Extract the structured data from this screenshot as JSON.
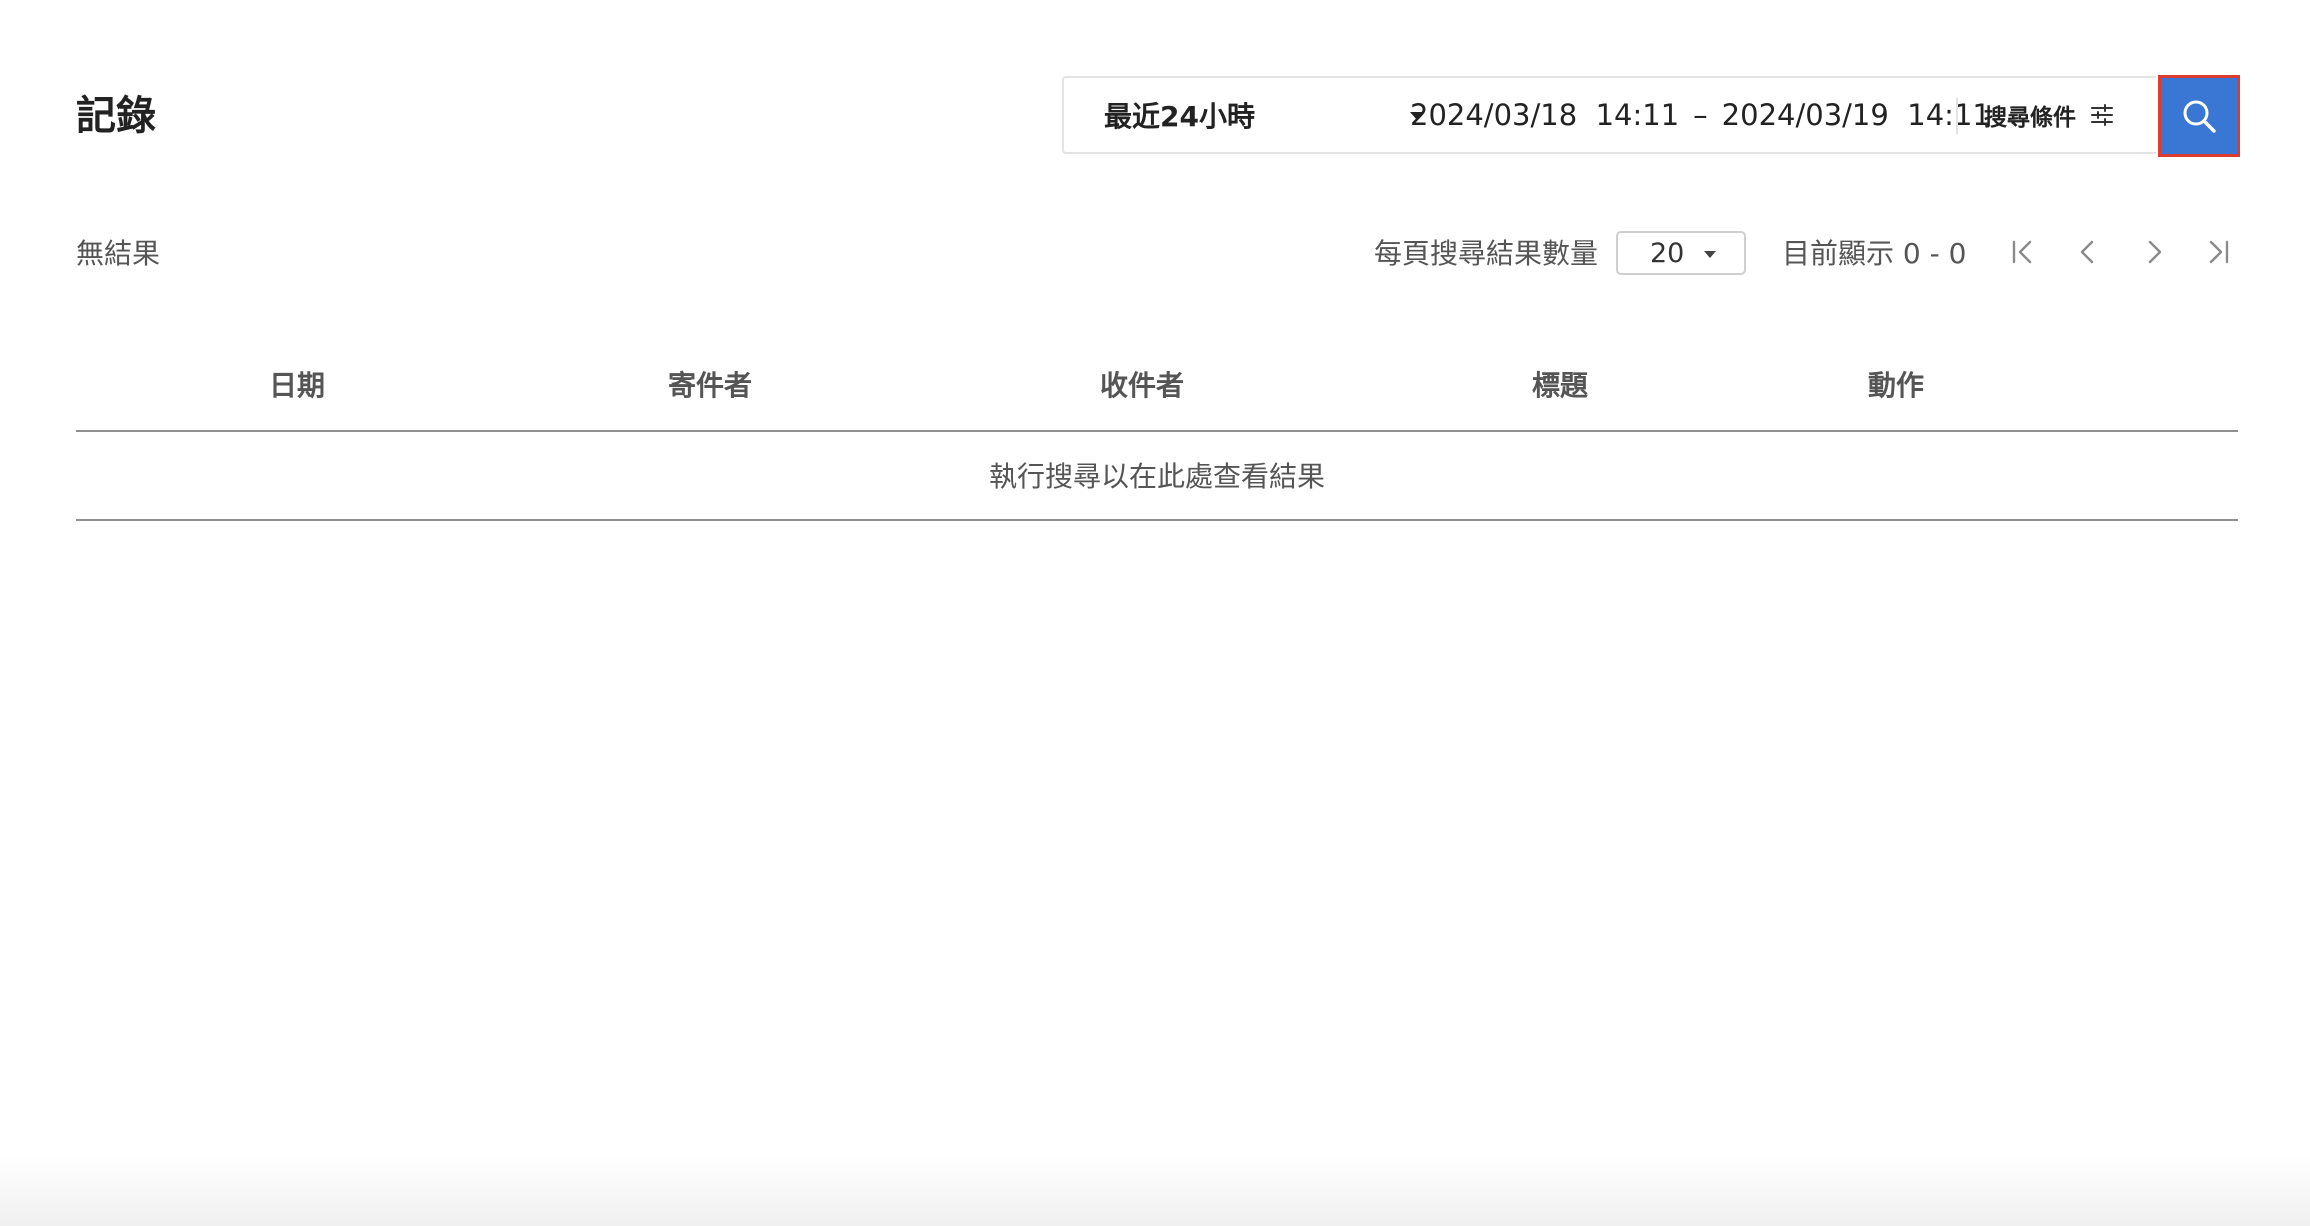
{
  "header": {
    "title": "記錄",
    "search_bar": {
      "range_selected": "最近24小時",
      "start_date": "2024/03/18",
      "start_time": "14:11",
      "separator": "–",
      "end_date": "2024/03/19",
      "end_time": "14:11",
      "criteria_label": "搜尋條件",
      "criteria_icon": "sliders-icon",
      "search_icon": "search-icon"
    }
  },
  "toolbar": {
    "results_status": "無結果",
    "per_page_label": "每頁搜尋結果數量",
    "per_page_value": "20",
    "showing_label": "目前顯示 0 - 0",
    "pager_icons": [
      "first-page-icon",
      "previous-page-icon",
      "next-page-icon",
      "last-page-icon"
    ]
  },
  "table": {
    "columns": [
      "日期",
      "寄件者",
      "收件者",
      "標題",
      "動作"
    ],
    "empty_message": "執行搜尋以在此處查看結果"
  },
  "colors": {
    "search_button_bg": "#3a76d3",
    "search_button_border": "#dc3b30",
    "divider": "#8f8f8f"
  }
}
